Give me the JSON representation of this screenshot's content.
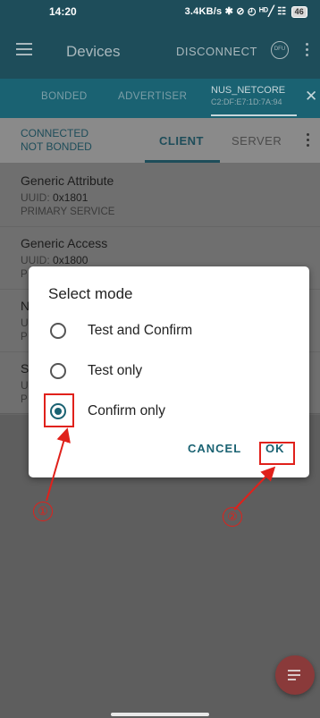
{
  "status_bar": {
    "time": "14:20",
    "indicators": "3.4KB/s ✱ ⊘ ◴ ᴴᴰ╱ ☷",
    "battery": "46"
  },
  "app_bar": {
    "title": "Devices",
    "disconnect_label": "DISCONNECT",
    "dfu_label": "DFU"
  },
  "tabs": {
    "bonded": "BONDED",
    "advertiser": "ADVERTISER",
    "device_name": "NUS_NETCORE",
    "device_address": "C2:DF:E7:1D:7A:94"
  },
  "connection": {
    "state_line1": "CONNECTED",
    "state_line2": "NOT BONDED",
    "client_tab": "CLIENT",
    "server_tab": "SERVER"
  },
  "services": [
    {
      "name": "Generic Attribute",
      "uuid_label": "UUID:",
      "uuid": "0x1801",
      "type": "PRIMARY SERVICE"
    },
    {
      "name": "Generic Access",
      "uuid_label": "UUID:",
      "uuid": "0x1800",
      "type": "P"
    },
    {
      "name": "N",
      "uuid_label": "U",
      "uuid": "",
      "type": "P"
    },
    {
      "name": "S",
      "uuid_label": "U",
      "uuid": "",
      "type": "P"
    }
  ],
  "dialog": {
    "title": "Select mode",
    "options": [
      {
        "label": "Test and Confirm",
        "selected": false
      },
      {
        "label": "Test only",
        "selected": false
      },
      {
        "label": "Confirm only",
        "selected": true
      }
    ],
    "cancel_label": "CANCEL",
    "ok_label": "OK"
  },
  "annotations": {
    "marker_1": "①",
    "marker_2": "②",
    "color": "#e0211b"
  },
  "colors": {
    "primary": "#1e4d5a",
    "accent": "#1a6272",
    "fab": "#8a3a3a"
  }
}
